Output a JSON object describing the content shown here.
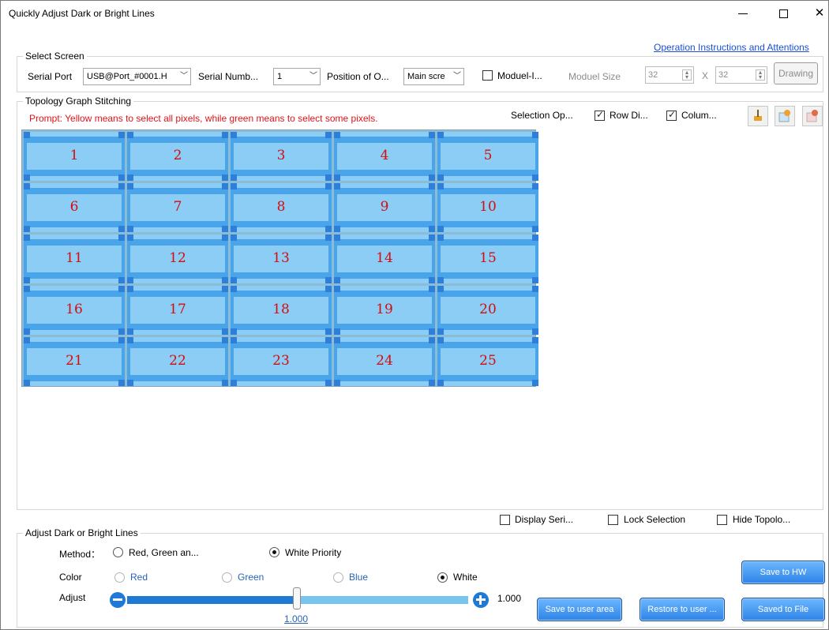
{
  "window": {
    "title": "Quickly Adjust Dark or Bright Lines",
    "minimize": "–",
    "close": "✕"
  },
  "links": {
    "instructions": "Operation Instructions and Attentions"
  },
  "select_screen": {
    "title": "Select Screen",
    "serial_port_label": "Serial Port",
    "serial_port_value": "USB@Port_#0001.H",
    "serial_number_label": "Serial Numb...",
    "serial_number_value": "1",
    "position_label": "Position of O...",
    "position_value": "Main scre",
    "module_checkbox_label": "Moduel-I...",
    "module_size_label": "Moduel Size",
    "module_width": "32",
    "module_height": "32",
    "times": "X",
    "drawing_button": "Drawing"
  },
  "topology": {
    "title": "Topology Graph Stitching",
    "prompt": "Prompt: Yellow means to select all pixels, while green means to select some pixels.",
    "selection_label": "Selection Op...",
    "row_label": "Row Di...",
    "column_label": "Colum...",
    "cells": [
      "1",
      "2",
      "3",
      "4",
      "5",
      "6",
      "7",
      "8",
      "9",
      "10",
      "11",
      "12",
      "13",
      "14",
      "15",
      "16",
      "17",
      "18",
      "19",
      "20",
      "21",
      "22",
      "23",
      "24",
      "25"
    ],
    "display_serial": "Display Seri...",
    "lock_selection": "Lock Selection",
    "hide_topology": "Hide Topolo..."
  },
  "adjust": {
    "title": "Adjust Dark or Bright Lines",
    "method_label": "Method：",
    "method_rgb": "Red, Green an...",
    "method_white": "White Priority",
    "color_label": "Color",
    "color_red": "Red",
    "color_green": "Green",
    "color_blue": "Blue",
    "color_white": "White",
    "adjust_label": "Adjust",
    "value_right": "1.000",
    "value_below": "1.000",
    "slider_value": 0.505
  },
  "buttons": {
    "save_hw": "Save to HW",
    "save_user": "Save to user area",
    "restore_user": "Restore to user ...",
    "saved_file": "Saved to File"
  },
  "colors": {
    "accent": "#2d83e6",
    "prompt": "#e0141c",
    "cell_number": "#d40d0d"
  }
}
